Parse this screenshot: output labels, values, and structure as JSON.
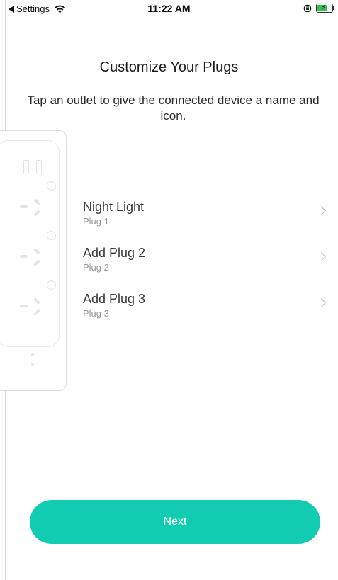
{
  "status_bar": {
    "back_label": "Settings",
    "time": "11:22 AM"
  },
  "header": {
    "title": "Customize Your Plugs",
    "subtitle": "Tap an outlet to give the connected device a name and icon."
  },
  "plugs": [
    {
      "name": "Night Light",
      "sub": "Plug 1"
    },
    {
      "name": "Add Plug 2",
      "sub": "Plug 2"
    },
    {
      "name": "Add Plug 3",
      "sub": "Plug 3"
    }
  ],
  "next_button": {
    "label": "Next"
  },
  "colors": {
    "accent": "#12ccb2",
    "battery": "#37c24a"
  }
}
